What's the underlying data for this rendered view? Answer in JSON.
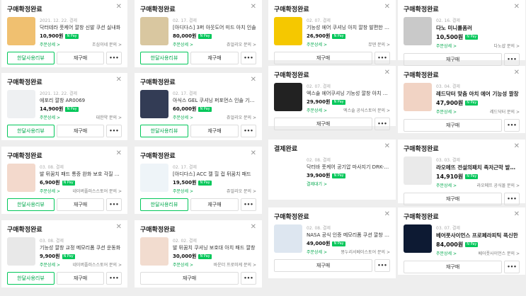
{
  "close_glyph": "✕",
  "more_glyph": "•••",
  "npay_label": "N Pay",
  "columns": [
    [
      {
        "status": "구매확정완료",
        "date": "2021. 12. 22. 결제",
        "title": "닥터테라 풋케어 깔창 신발 쿠션 실내화",
        "price": "10,900원",
        "detail": "주문상세 >",
        "seller": "조심이네 문의 >",
        "primary": "한달사용리뷰",
        "secondary": "재구매",
        "thumb": "#f0c070"
      },
      {
        "status": "구매확정완료",
        "date": "2021. 12. 22. 결제",
        "title": "에포리 깔창 AR0069",
        "price": "14,900원",
        "detail": "주문상세 >",
        "seller": "대한약 문의 >",
        "primary": "한달사용리뷰",
        "secondary": "재구매",
        "thumb": "#eef0f2"
      },
      {
        "status": "구매확정완료",
        "date": "03. 08. 결제",
        "title": "발 뒤꿈치 패드 통증 완화 보호 각질 케어",
        "price": "6,900원",
        "detail": "주문상세 >",
        "seller": "네이버플러스스토어 문의 >",
        "primary": "한달사용리뷰",
        "secondary": "재구매",
        "thumb": "#f3d9cc"
      },
      {
        "status": "구매확정완료",
        "date": "03. 08. 결제",
        "title": "기능성 깔창 교정 메모리폼 쿠션 운동화",
        "price": "9,900원",
        "detail": "주문상세 >",
        "seller": "네이버플러스스토어 문의 >",
        "primary": "한달사용리뷰",
        "secondary": "재구매",
        "thumb": "#e8e8e8"
      }
    ],
    [
      {
        "status": "구매확정완료",
        "date": "02. 17. 결제",
        "title": "[아디다스] 3퍼 아웃도어 미드 아치 인솔",
        "price": "80,000원",
        "detail": "주문상세 >",
        "seller": "쥬얼리오 문의 >",
        "primary": "한달사용리뷰",
        "secondary": "재구매",
        "thumb": "#d9c7a0"
      },
      {
        "status": "구매확정완료",
        "date": "02. 17. 결제",
        "title": "아식스 GEL 쿠셔닝 퍼포먼스 인솔 기능성",
        "price": "60,000원",
        "detail": "주문상세 >",
        "seller": "쥬얼리오 문의 >",
        "primary": "한달사용리뷰",
        "secondary": "재구매",
        "thumb": "#333c55"
      },
      {
        "status": "구매확정완료",
        "date": "02. 17. 결제",
        "title": "[아디다스] ACC 젤 힐 컵 뒤꿈치 패드",
        "price": "19,500원",
        "detail": "주문상세 >",
        "seller": "쥬얼리오 문의 >",
        "primary": "한달사용리뷰",
        "secondary": "재구매",
        "thumb": "#eef4f8"
      },
      {
        "status": "구매확정완료",
        "date": "02. 02. 결제",
        "title": "발 뒤꿈치 쿠셔닝 보호대 아치 패드 깔창",
        "price": "30,000원",
        "detail": "주문상세 >",
        "seller": "바운더 프로미케 문의 >",
        "primary": "",
        "secondary": "재구매",
        "thumb": "#f2dccf"
      }
    ],
    [
      {
        "status": "구매확정완료",
        "date": "02. 07. 결제",
        "title": "기능성 에어 쿠셔닝 아치 깔창 발편한 인솔",
        "price": "26,900원",
        "detail": "주문상세 >",
        "seller": "뮤덴 문의 >",
        "primary": "",
        "secondary": "재구매",
        "thumb": "#f5c800"
      },
      {
        "status": "구매확정완료",
        "date": "02. 07. 결제",
        "title": "엑스솔 에어쿠셔닝 기능성 깔창 아치 에어",
        "price": "29,900원",
        "detail": "주문상세 >",
        "seller": "엑스솔 공식스토어 문의 >",
        "primary": "",
        "secondary": "재구매",
        "thumb": "#222222"
      },
      {
        "status": "결제완료",
        "date": "02. 08. 결제",
        "title": "닥터바 풋케어 공기압 마사지기 DRK-L7000",
        "price": "39,900원",
        "detail": "결제대기 >",
        "seller": "",
        "primary": "",
        "secondary": "",
        "thumb": "#ffffff"
      },
      {
        "status": "구매확정완료",
        "date": "02. 08. 결제",
        "title": "NASA 공식 인증 메모리폼 쿠션 깔창 슬리퍼",
        "price": "49,000원",
        "detail": "주문상세 >",
        "seller": "몽누리서베이스토어 문의 >",
        "primary": "",
        "secondary": "재구매",
        "thumb": "#dde6f0"
      }
    ],
    [
      {
        "status": "구매확정완료",
        "date": "02. 16. 결제",
        "title": "다노 미니롤폼러",
        "price": "10,500원",
        "detail": "주문상세 >",
        "seller": "다노샵 문의 >",
        "primary": "",
        "secondary": "재구매",
        "thumb": "#c9c9c9"
      },
      {
        "status": "구매확정완료",
        "date": "03. 04. 결제",
        "title": "레드닥터 맞춤 아치 에어 기능성 깔창",
        "price": "47,900원",
        "detail": "주문상세 >",
        "seller": "레드닥터 문의 >",
        "primary": "",
        "secondary": "재구매",
        "thumb": "#f1d3c4"
      },
      {
        "status": "구매확정완료",
        "date": "03. 03. 결제",
        "title": "라오메뜨 전설의패치 족저근막 발바닥",
        "price": "14,910원",
        "detail": "주문상세 >",
        "seller": "라오메뜨 공식몰 문의 >",
        "primary": "",
        "secondary": "재구매",
        "thumb": "#eaeaea"
      },
      {
        "status": "구매확정완료",
        "date": "03. 07. 결제",
        "title": "베어풋사이언스 프로페라피틱 푹신한",
        "price": "84,000원",
        "detail": "주문상세 >",
        "seller": "베어풋사이언스 문의 >",
        "primary": "",
        "secondary": "재구매",
        "thumb": "#0d1a33"
      }
    ]
  ]
}
